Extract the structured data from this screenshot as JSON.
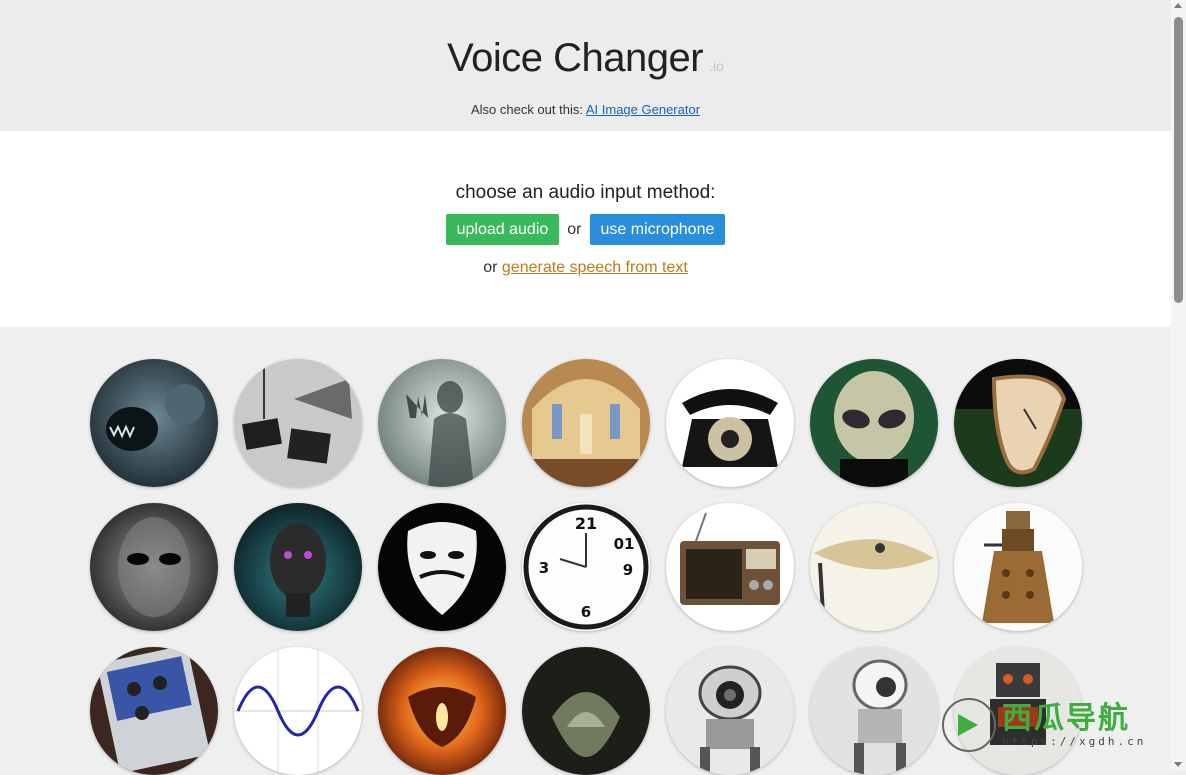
{
  "header": {
    "title": "Voice Changer",
    "title_suffix": ".io",
    "also_text": "Also check out this:",
    "also_link": "AI Image Generator"
  },
  "input": {
    "prompt": "choose an audio input method:",
    "upload_label": "upload audio",
    "or_label": "or",
    "mic_label": "use microphone",
    "tts_prefix": "or",
    "tts_link": "generate speech from text"
  },
  "voices": [
    {
      "name": "cave-monster-voice-thumbnail"
    },
    {
      "name": "megaphone-voice-thumbnail"
    },
    {
      "name": "ghost-voice-thumbnail"
    },
    {
      "name": "cathedral-voice-thumbnail"
    },
    {
      "name": "telephone-voice-thumbnail"
    },
    {
      "name": "alien-voice-thumbnail"
    },
    {
      "name": "melting-clock-voice-thumbnail"
    },
    {
      "name": "grey-alien-voice-thumbnail"
    },
    {
      "name": "robot-mask-voice-thumbnail"
    },
    {
      "name": "anonymous-voice-thumbnail"
    },
    {
      "name": "reversed-clock-voice-thumbnail"
    },
    {
      "name": "radio-voice-thumbnail"
    },
    {
      "name": "cymbal-voice-thumbnail"
    },
    {
      "name": "dalek-voice-thumbnail"
    },
    {
      "name": "pedal-voice-thumbnail"
    },
    {
      "name": "sine-wave-voice-thumbnail"
    },
    {
      "name": "fire-demon-voice-thumbnail"
    },
    {
      "name": "dark-cave-voice-thumbnail"
    },
    {
      "name": "robot-eye-voice-thumbnail"
    },
    {
      "name": "robot-drone-voice-thumbnail"
    },
    {
      "name": "toy-robot-voice-thumbnail"
    }
  ],
  "watermark": {
    "main": "西瓜导航",
    "url": "https://xgdh.cn"
  },
  "colors": {
    "upload_button": "#37b95c",
    "mic_button": "#2a8edb",
    "link_orange": "#c07a1e",
    "link_blue": "#1a63b8"
  }
}
